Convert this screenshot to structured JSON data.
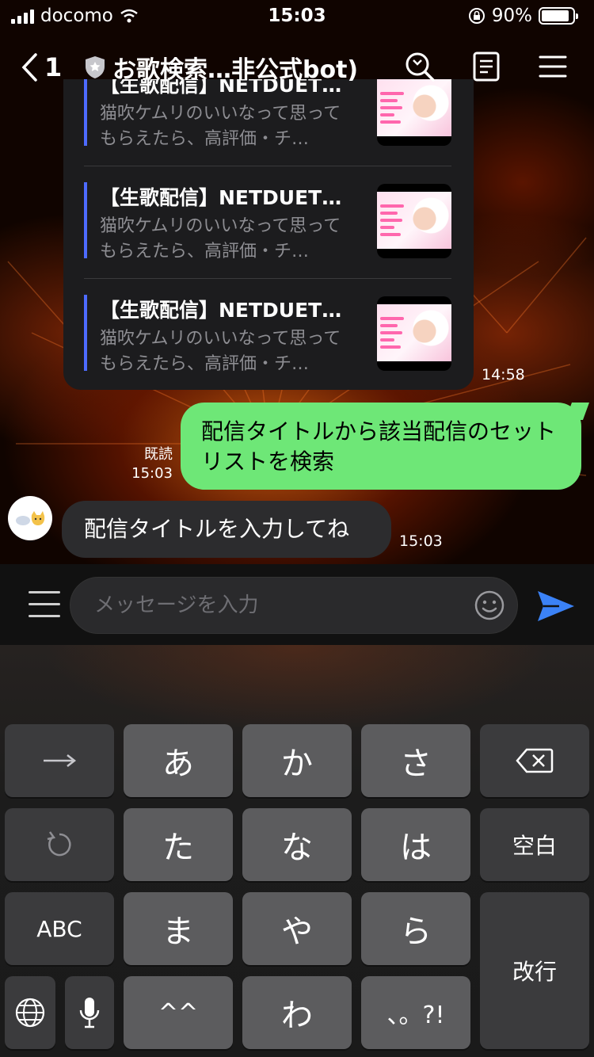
{
  "status_bar": {
    "carrier": "docomo",
    "time": "15:03",
    "battery": "90%",
    "battery_level": 0.9
  },
  "header": {
    "back_count": "1",
    "title": "お歌検索…非公式bot)"
  },
  "cards": [
    {
      "title": "【生歌配信】NETDUET…",
      "description": "猫吹ケムリのいいなって思ってもらえたら、高評価・チ…"
    },
    {
      "title": "【生歌配信】NETDUET…",
      "description": "猫吹ケムリのいいなって思ってもらえたら、高評価・チ…"
    },
    {
      "title": "【生歌配信】NETDUET…",
      "description": "猫吹ケムリのいいなって思ってもらえたら、高評価・チ…"
    }
  ],
  "messages": {
    "cards_time": "14:58",
    "outgoing": {
      "read_label": "既読",
      "time": "15:03",
      "text": "配信タイトルから該当配信のセットリストを検索"
    },
    "incoming": {
      "text": "配信タイトルを入力してね",
      "time": "15:03"
    }
  },
  "input": {
    "placeholder": "メッセージを入力"
  },
  "keyboard": {
    "row1": [
      "→",
      "あ",
      "か",
      "さ",
      "⌫"
    ],
    "row2": [
      "↺",
      "た",
      "な",
      "は",
      "空白"
    ],
    "row3": [
      "ABC",
      "ま",
      "や",
      "ら",
      "改行"
    ],
    "row4": [
      "🌐",
      "🎤",
      "^^",
      "わ",
      "、。?!"
    ]
  },
  "colors": {
    "accent_blue": "#4d6bff",
    "bubble_green": "#6ee777",
    "send_blue": "#3b82f6"
  }
}
